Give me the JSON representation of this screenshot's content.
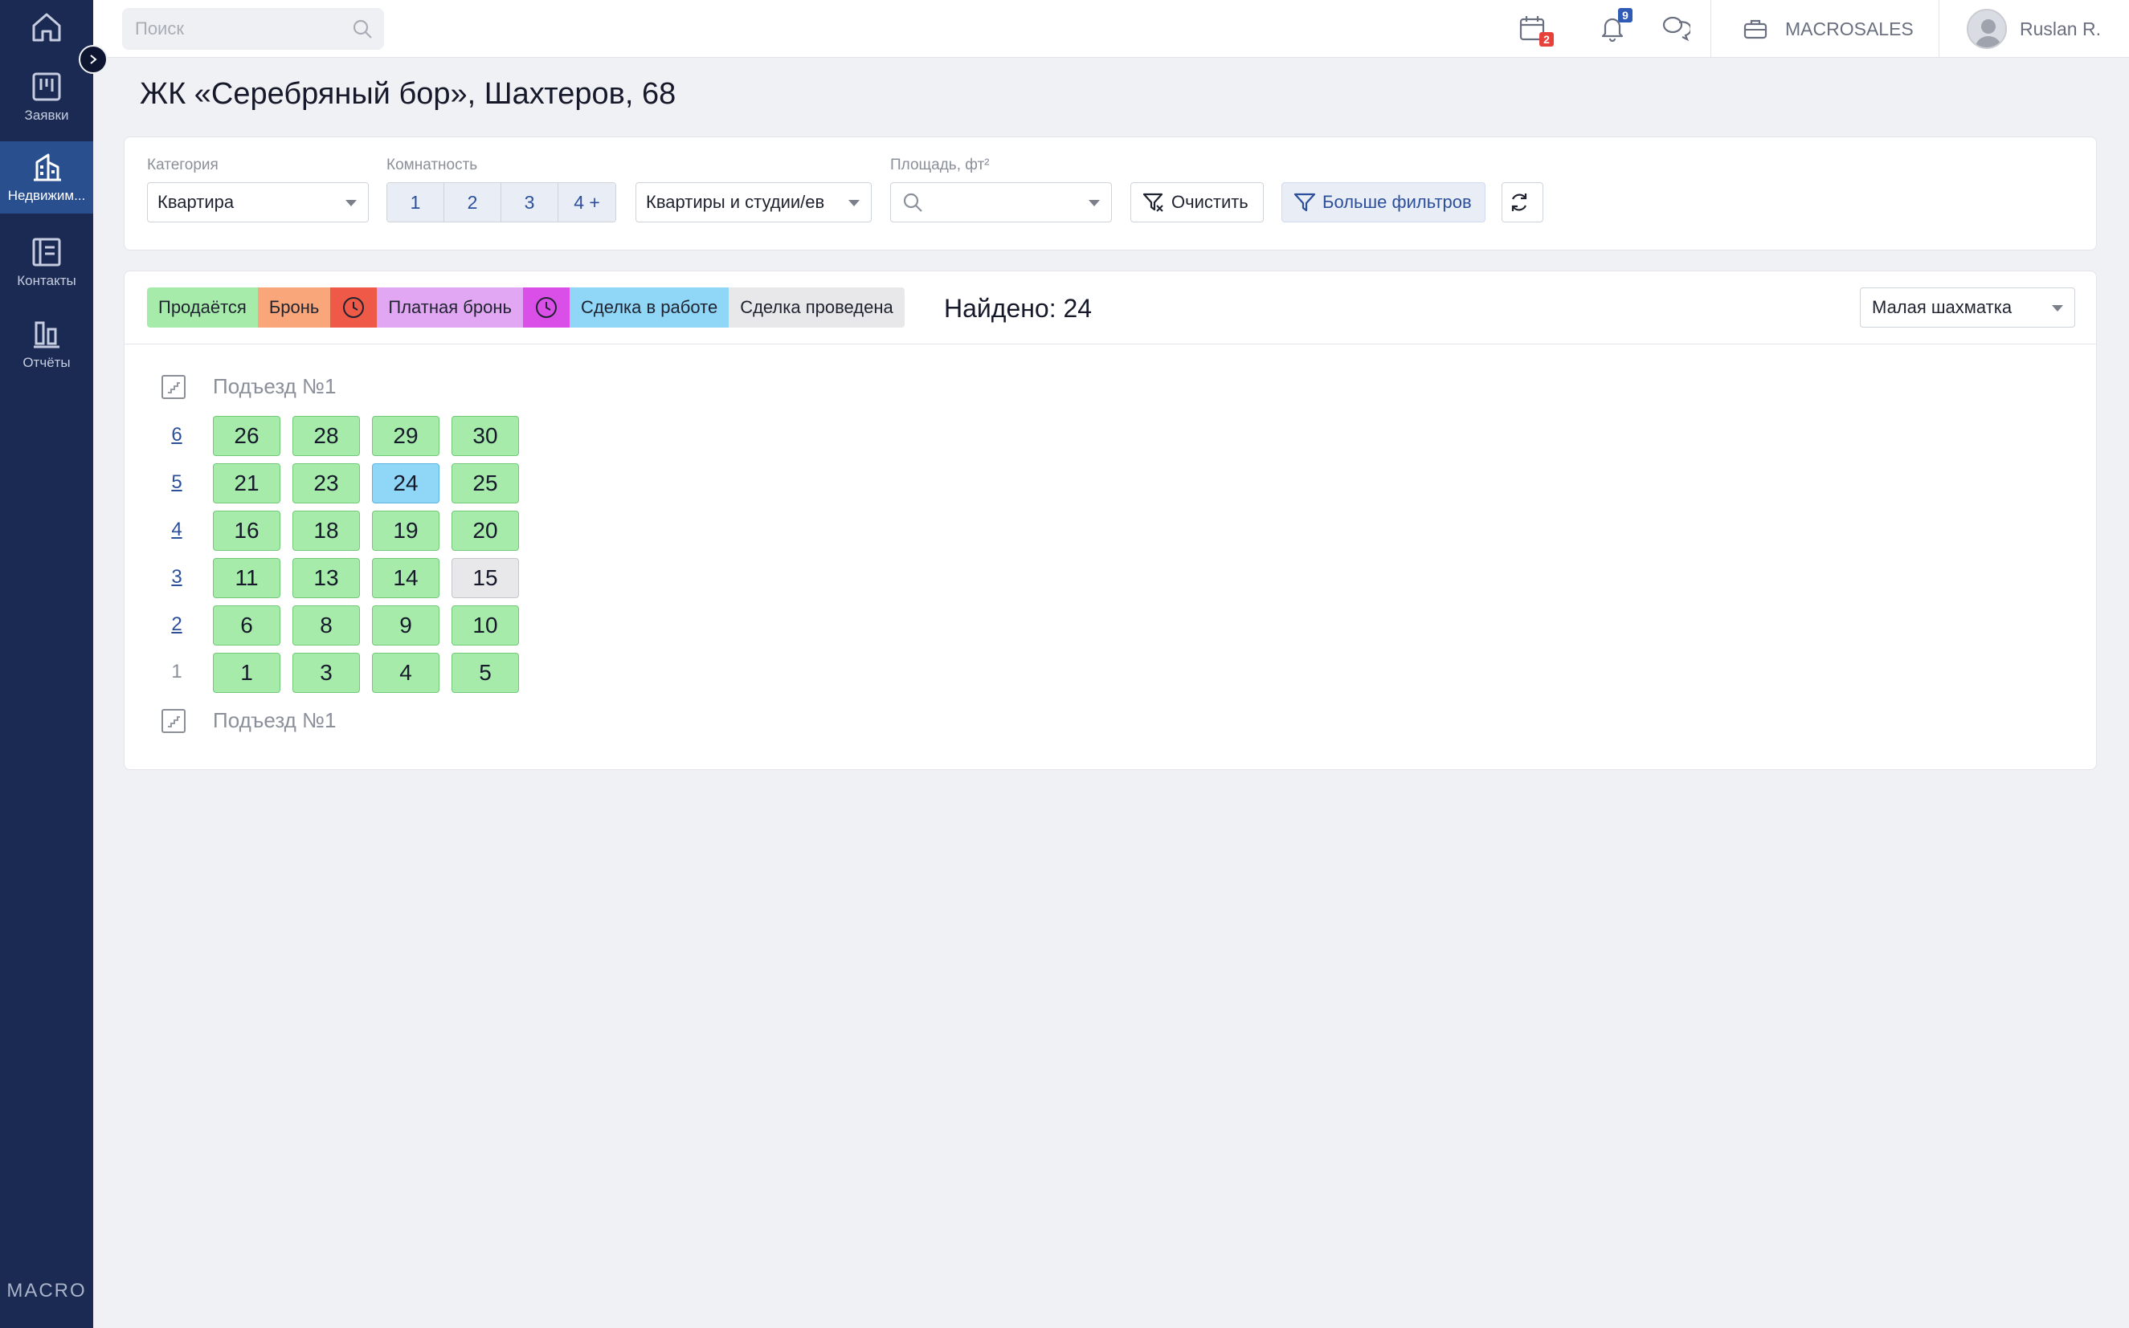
{
  "sidebar": {
    "items": [
      {
        "label": "",
        "icon": "home-icon"
      },
      {
        "label": "Заявки",
        "icon": "orders-icon"
      },
      {
        "label": "Недвижим...",
        "icon": "building-icon",
        "active": true
      },
      {
        "label": "Контакты",
        "icon": "contacts-icon"
      },
      {
        "label": "Отчёты",
        "icon": "reports-icon"
      }
    ],
    "logo": "MACRO"
  },
  "topbar": {
    "search_placeholder": "Поиск",
    "calendar_badge": "2",
    "notifications_badge": "9",
    "company": "MACROSALES",
    "user_name": "Ruslan R."
  },
  "page": {
    "title": "ЖК «Серебряный бор», Шахтеров, 68"
  },
  "filters": {
    "category_label": "Категория",
    "category_value": "Квартира",
    "rooms_label": "Комнатность",
    "rooms": [
      "1",
      "2",
      "3",
      "4 +"
    ],
    "type_value": "Квартиры и студии/ев",
    "area_label": "Площадь, фт²",
    "clear_label": "Очистить",
    "more_label": "Больше фильтров"
  },
  "legend": {
    "sale": "Продаётся",
    "booking": "Бронь",
    "paid_booking": "Платная бронь",
    "deal_in_progress": "Сделка в работе",
    "deal_done": "Сделка проведена"
  },
  "colors": {
    "sale": "#a7ebab",
    "booking": "#f9a77a",
    "booking_clock": "#ee5a47",
    "paid_booking": "#e2a7f2",
    "paid_booking_clock": "#d94fe8",
    "deal_in_progress": "#8fd6f7",
    "deal_done": "#e8e8ea",
    "sidebar": "#1b2a52",
    "sidebar_active": "#2a4f8f"
  },
  "found_text": "Найдено: 24",
  "view_select": "Малая шахматка",
  "entrance": {
    "label_top": "Подъезд №1",
    "label_bottom": "Подъезд №1"
  },
  "floors": [
    {
      "floor": "6",
      "flats": [
        {
          "n": "26",
          "s": "sale"
        },
        {
          "n": "28",
          "s": "sale"
        },
        {
          "n": "29",
          "s": "sale"
        },
        {
          "n": "30",
          "s": "sale"
        }
      ]
    },
    {
      "floor": "5",
      "flats": [
        {
          "n": "21",
          "s": "sale"
        },
        {
          "n": "23",
          "s": "sale"
        },
        {
          "n": "24",
          "s": "deal"
        },
        {
          "n": "25",
          "s": "sale"
        }
      ]
    },
    {
      "floor": "4",
      "flats": [
        {
          "n": "16",
          "s": "sale"
        },
        {
          "n": "18",
          "s": "sale"
        },
        {
          "n": "19",
          "s": "sale"
        },
        {
          "n": "20",
          "s": "sale"
        }
      ]
    },
    {
      "floor": "3",
      "flats": [
        {
          "n": "11",
          "s": "sale"
        },
        {
          "n": "13",
          "s": "sale"
        },
        {
          "n": "14",
          "s": "sale"
        },
        {
          "n": "15",
          "s": "done"
        }
      ]
    },
    {
      "floor": "2",
      "flats": [
        {
          "n": "6",
          "s": "sale"
        },
        {
          "n": "8",
          "s": "sale"
        },
        {
          "n": "9",
          "s": "sale"
        },
        {
          "n": "10",
          "s": "sale"
        }
      ]
    },
    {
      "floor": "1",
      "flats": [
        {
          "n": "1",
          "s": "sale"
        },
        {
          "n": "3",
          "s": "sale"
        },
        {
          "n": "4",
          "s": "sale"
        },
        {
          "n": "5",
          "s": "sale"
        }
      ]
    }
  ]
}
